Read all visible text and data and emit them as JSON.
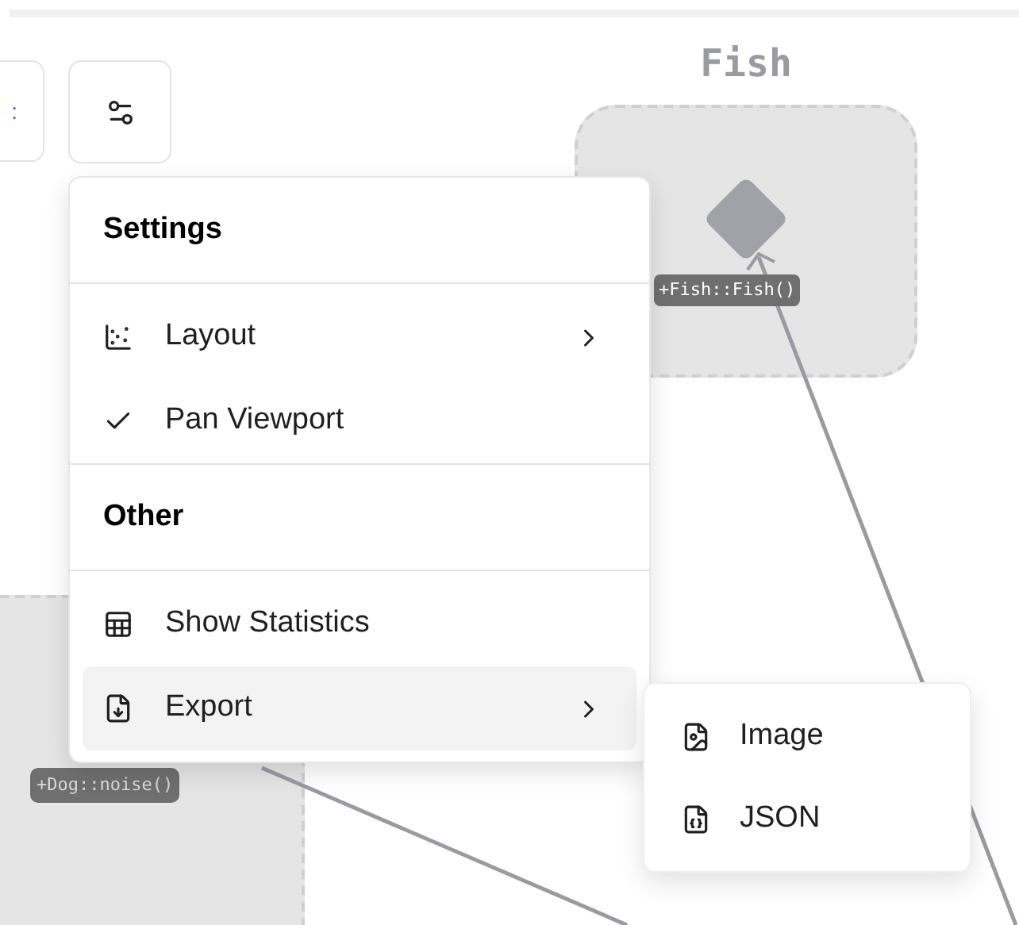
{
  "canvas": {
    "nodes": [
      {
        "kind": "fish",
        "title": "Fish",
        "label": "+Fish::Fish()"
      },
      {
        "kind": "dog",
        "label": "+Dog::noise()"
      }
    ]
  },
  "toolbar": {
    "partial_button_glyph": ":"
  },
  "menu": {
    "sections": [
      {
        "header": "Settings",
        "items": [
          {
            "kind": "layout",
            "label": "Layout",
            "submenu": true,
            "selected": false
          },
          {
            "kind": "toggle",
            "label": "Pan Viewport",
            "checked": true,
            "submenu": false,
            "selected": false
          }
        ]
      },
      {
        "header": "Other",
        "items": [
          {
            "kind": "table",
            "label": "Show Statistics",
            "submenu": false,
            "selected": false
          },
          {
            "kind": "export",
            "label": "Export",
            "submenu": true,
            "selected": true
          }
        ]
      }
    ]
  },
  "submenu": {
    "items": [
      {
        "kind": "image",
        "label": "Image"
      },
      {
        "kind": "json",
        "label": "JSON"
      }
    ]
  }
}
